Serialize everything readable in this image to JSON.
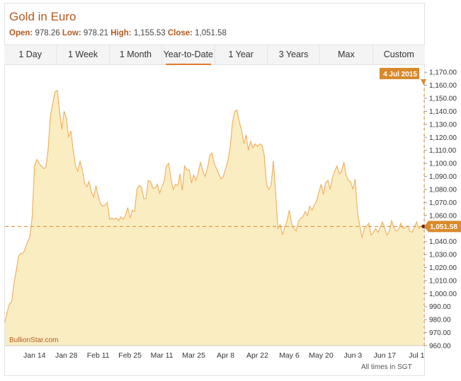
{
  "header": {
    "title": "Gold in Euro",
    "open_label": "Open:",
    "open_value": "978.26",
    "low_label": "Low:",
    "low_value": "978.21",
    "high_label": "High:",
    "high_value": "1,155.53",
    "close_label": "Close:",
    "close_value": "1,051.58"
  },
  "tabs": [
    {
      "label": "1 Day",
      "active": false
    },
    {
      "label": "1 Week",
      "active": false
    },
    {
      "label": "1 Month",
      "active": false
    },
    {
      "label": "Year-to-Date",
      "active": true
    },
    {
      "label": "1 Year",
      "active": false
    },
    {
      "label": "3 Years",
      "active": false
    },
    {
      "label": "Max",
      "active": false
    },
    {
      "label": "Custom",
      "active": false
    }
  ],
  "colors": {
    "accent": "#b35a1f",
    "area_fill": "#fbedc2",
    "line": "#f0b266",
    "marker": "#d98a2b",
    "last_point": "#6b1f0e"
  },
  "brand": "BullionStar.com",
  "footnote": "All times in SGT",
  "chart_data": {
    "type": "area",
    "ylim": [
      960,
      1175
    ],
    "y_ticks": [
      960,
      970,
      980,
      990,
      1000,
      1010,
      1020,
      1030,
      1040,
      1050,
      1060,
      1070,
      1080,
      1090,
      1100,
      1110,
      1120,
      1130,
      1140,
      1150,
      1160,
      1170
    ],
    "y_tick_labels": [
      "960.00",
      "970.00",
      "980.00",
      "990.00",
      "1,000.00",
      "1,010.00",
      "1,020.00",
      "1,030.00",
      "1,040.00",
      "1,050.00",
      "1,060.00",
      "1,070.00",
      "1,080.00",
      "1,090.00",
      "1,100.00",
      "1,110.00",
      "1,120.00",
      "1,130.00",
      "1,140.00",
      "1,150.00",
      "1,160.00",
      "1,170.00"
    ],
    "x_ticks": [
      {
        "label": "Jan 14",
        "day": 14
      },
      {
        "label": "Jan 28",
        "day": 28
      },
      {
        "label": "Feb 11",
        "day": 42
      },
      {
        "label": "Feb 25",
        "day": 56
      },
      {
        "label": "Mar 11",
        "day": 70
      },
      {
        "label": "Mar 25",
        "day": 84
      },
      {
        "label": "Apr 8",
        "day": 98
      },
      {
        "label": "Apr 22",
        "day": 112
      },
      {
        "label": "May 6",
        "day": 126
      },
      {
        "label": "May 20",
        "day": 140
      },
      {
        "label": "Jun 3",
        "day": 154
      },
      {
        "label": "Jun 17",
        "day": 168
      },
      {
        "label": "Jul 1",
        "day": 182
      }
    ],
    "x_domain": [
      1,
      185
    ],
    "last_value": 1051.58,
    "last_value_label": "1,051.58",
    "last_date_label": "4 Jul 2015",
    "series": [
      {
        "x": [
          1,
          2,
          3,
          4,
          5,
          6,
          7,
          8,
          9,
          10,
          11,
          12,
          13,
          14,
          15,
          16,
          17,
          18,
          19,
          20,
          21,
          22,
          23,
          24,
          25,
          26,
          27,
          28,
          29,
          30,
          31,
          32,
          33,
          34,
          35,
          36,
          37,
          38,
          39,
          40,
          41,
          42,
          43,
          44,
          45,
          46,
          47,
          48,
          49,
          50,
          51,
          52,
          53,
          54,
          55,
          56,
          57,
          58,
          59,
          60,
          61,
          62,
          63,
          64,
          65,
          66,
          67,
          68,
          69,
          70,
          71,
          72,
          73,
          74,
          75,
          76,
          77,
          78,
          79,
          80,
          81,
          82,
          83,
          84,
          85,
          86,
          87,
          88,
          89,
          90,
          91,
          92,
          93,
          94,
          95,
          96,
          97,
          98,
          99,
          100,
          101,
          102,
          103,
          104,
          105,
          106,
          107,
          108,
          109,
          110,
          111,
          112,
          113,
          114,
          115,
          116,
          117,
          118,
          119,
          120,
          121,
          122,
          123,
          124,
          125,
          126,
          127,
          128,
          129,
          130,
          131,
          132,
          133,
          134,
          135,
          136,
          137,
          138,
          139,
          140,
          141,
          142,
          143,
          144,
          145,
          146,
          147,
          148,
          149,
          150,
          151,
          152,
          153,
          154,
          155,
          156,
          157,
          158,
          159,
          160,
          161,
          162,
          163,
          164,
          165,
          166,
          167,
          168,
          169,
          170,
          171,
          172,
          173,
          174,
          175,
          176,
          177,
          178,
          179,
          180,
          181,
          182,
          183,
          184,
          185
        ],
        "values": [
          978,
          986,
          992,
          994,
          1008,
          1018,
          1029,
          1031,
          1031,
          1035,
          1040,
          1044,
          1059,
          1098,
          1103,
          1100,
          1098,
          1096,
          1097,
          1111,
          1136,
          1146,
          1155,
          1156,
          1140,
          1126,
          1140,
          1135,
          1120,
          1125,
          1110,
          1098,
          1094,
          1102,
          1095,
          1085,
          1082,
          1086,
          1078,
          1074,
          1083,
          1075,
          1069,
          1067,
          1068,
          1070,
          1057,
          1058,
          1057,
          1058,
          1056,
          1059,
          1057,
          1060,
          1066,
          1058,
          1064,
          1063,
          1080,
          1083,
          1082,
          1073,
          1073,
          1087,
          1086,
          1081,
          1081,
          1084,
          1077,
          1082,
          1086,
          1098,
          1100,
          1088,
          1080,
          1084,
          1083,
          1092,
          1079,
          1098,
          1095,
          1095,
          1085,
          1091,
          1087,
          1093,
          1101,
          1094,
          1090,
          1096,
          1106,
          1108,
          1100,
          1096,
          1092,
          1088,
          1090,
          1096,
          1102,
          1112,
          1131,
          1140,
          1141,
          1132,
          1126,
          1115,
          1122,
          1110,
          1117,
          1112,
          1115,
          1113,
          1115,
          1114,
          1106,
          1084,
          1080,
          1083,
          1102,
          1078,
          1050,
          1053,
          1045,
          1051,
          1056,
          1064,
          1054,
          1050,
          1048,
          1055,
          1058,
          1059,
          1063,
          1060,
          1067,
          1064,
          1068,
          1071,
          1078,
          1084,
          1076,
          1085,
          1087,
          1080,
          1089,
          1094,
          1098,
          1092,
          1094,
          1101,
          1091,
          1087,
          1086,
          1080,
          1088,
          1062,
          1052,
          1043,
          1050,
          1052,
          1054,
          1045,
          1047,
          1050,
          1047,
          1051,
          1055,
          1050,
          1045,
          1048,
          1056,
          1051,
          1048,
          1049,
          1054,
          1050,
          1051,
          1052,
          1048,
          1047,
          1051,
          1055,
          1050,
          1052,
          1051.58
        ]
      }
    ]
  }
}
